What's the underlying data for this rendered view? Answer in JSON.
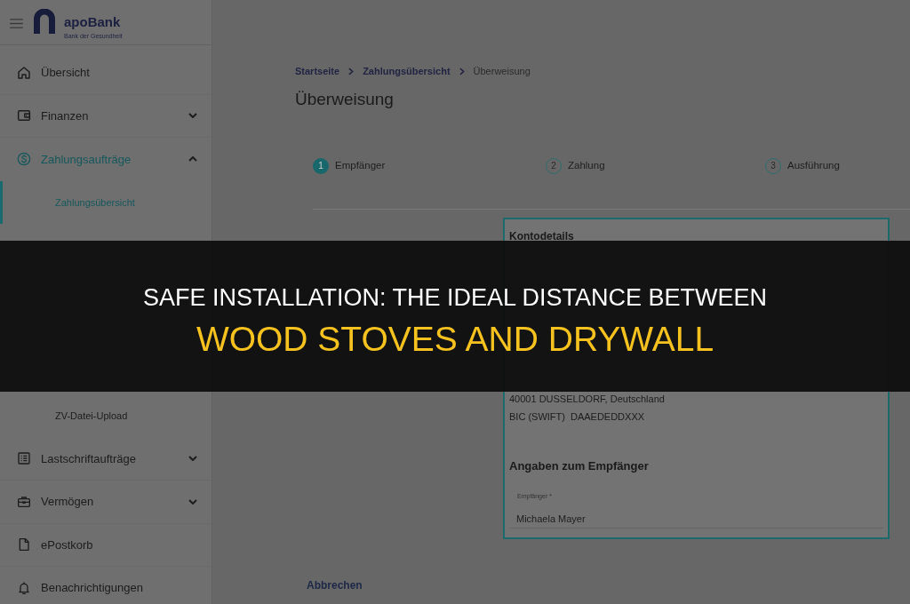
{
  "header": {
    "logo": {
      "name": "apoBank",
      "tagline": "Bank der Gesundheit"
    }
  },
  "sidebar": {
    "items": [
      {
        "label": "Übersicht",
        "kind": "link",
        "selected": false
      },
      {
        "label": "Finanzen",
        "kind": "group",
        "expanded": false,
        "selected": false
      },
      {
        "label": "Zahlungsaufträge",
        "kind": "group",
        "expanded": true,
        "selected": true,
        "children": [
          {
            "label": "Zahlungsübersicht",
            "selected": true
          },
          {
            "label": "ZV-Datei-Upload",
            "selected": false
          }
        ]
      },
      {
        "label": "Lastschriftaufträge",
        "kind": "group",
        "expanded": false,
        "selected": false
      },
      {
        "label": "Vermögen",
        "kind": "group",
        "expanded": false,
        "selected": false
      },
      {
        "label": "ePostkorb",
        "kind": "link",
        "selected": false
      },
      {
        "label": "Benachrichtigungen",
        "kind": "link",
        "selected": false
      }
    ]
  },
  "breadcrumb": [
    {
      "label": "Startseite",
      "kind": "link"
    },
    {
      "label": "Zahlungsübersicht",
      "kind": "link"
    },
    {
      "label": "Überweisung",
      "kind": "current"
    }
  ],
  "page_title": "Überweisung",
  "stepper": [
    {
      "number": "1",
      "label": "Empfänger",
      "selected": true
    },
    {
      "number": "2",
      "label": "Zahlung",
      "selected": false
    },
    {
      "number": "3",
      "label": "Ausführung",
      "selected": false
    }
  ],
  "account_card": {
    "title": "Kontodetails",
    "bank_lines": [
      "40001 DUSSELDORF, Deutschland"
    ],
    "bic": {
      "label": "BIC (SWIFT)",
      "value": "DAAEDEDDXXX"
    },
    "recipient_section": {
      "title": "Angaben zum Empfänger",
      "field": {
        "label": "Empfänger *",
        "value": "Michaela Mayer"
      }
    }
  },
  "cancel_button": "Abbrechen",
  "overlay_banner": {
    "lines": [
      {
        "text": "SAFE INSTALLATION: THE IDEAL DISTANCE BETWEEN",
        "kind": "plain"
      },
      {
        "text": "WOOD STOVES AND DRYWALL",
        "kind": "highlight"
      }
    ]
  }
}
